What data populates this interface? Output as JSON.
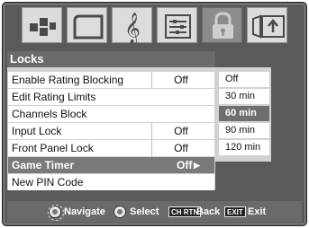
{
  "menu": {
    "title": "Locks",
    "items": [
      {
        "label": "Enable Rating Blocking",
        "value": "Off"
      },
      {
        "label": "Edit Rating Limits",
        "value": ""
      },
      {
        "label": "Channels Block",
        "value": ""
      },
      {
        "label": "Input Lock",
        "value": "Off"
      },
      {
        "label": "Front Panel Lock",
        "value": "Off"
      },
      {
        "label": "Game Timer",
        "value": "Off",
        "selected": true
      },
      {
        "label": "New PIN Code",
        "value": ""
      }
    ]
  },
  "submenu": {
    "options": [
      "Off",
      "30 min",
      "60 min",
      "90 min",
      "120 min"
    ],
    "active": "60 min"
  },
  "tabs": [
    {
      "icon": "picture-icon"
    },
    {
      "icon": "screen-icon"
    },
    {
      "icon": "audio-icon"
    },
    {
      "icon": "setup-icon"
    },
    {
      "icon": "lock-icon",
      "active": true
    },
    {
      "icon": "applications-icon"
    }
  ],
  "footer": {
    "navigate": "Navigate",
    "select": "Select",
    "back_key": "CH RTN",
    "back": "Back",
    "exit_key": "EXIT",
    "exit": "Exit"
  }
}
